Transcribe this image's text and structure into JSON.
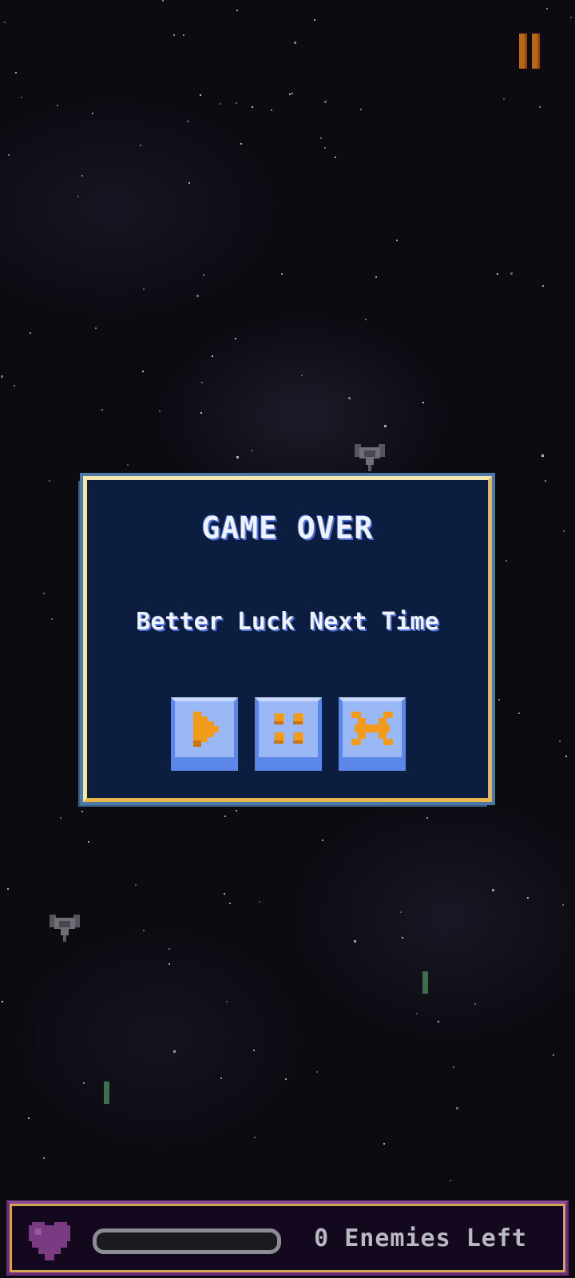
{
  "dialog": {
    "title": "GAME OVER",
    "subtitle": "Better Luck Next Time",
    "buttons": [
      {
        "id": "play",
        "icon": "play-icon"
      },
      {
        "id": "menu",
        "icon": "menu-dots-icon"
      },
      {
        "id": "close",
        "icon": "close-icon"
      }
    ]
  },
  "hud": {
    "enemies_count": "0",
    "enemies_label": "Enemies Left",
    "enemies_text": "0 Enemies Left",
    "health_fraction": 0,
    "heart_icon": "heart-icon"
  },
  "top": {
    "pause_icon": "pause-icon"
  },
  "colors": {
    "dialog_bg": "#0c1e40",
    "dialog_border": "#e9b54a",
    "button_face": "#9ab8f5",
    "button_glyph": "#f29a1a",
    "pause": "#b8661a",
    "hud_border": "#6a2c7a",
    "heart": "#7a3b82"
  }
}
